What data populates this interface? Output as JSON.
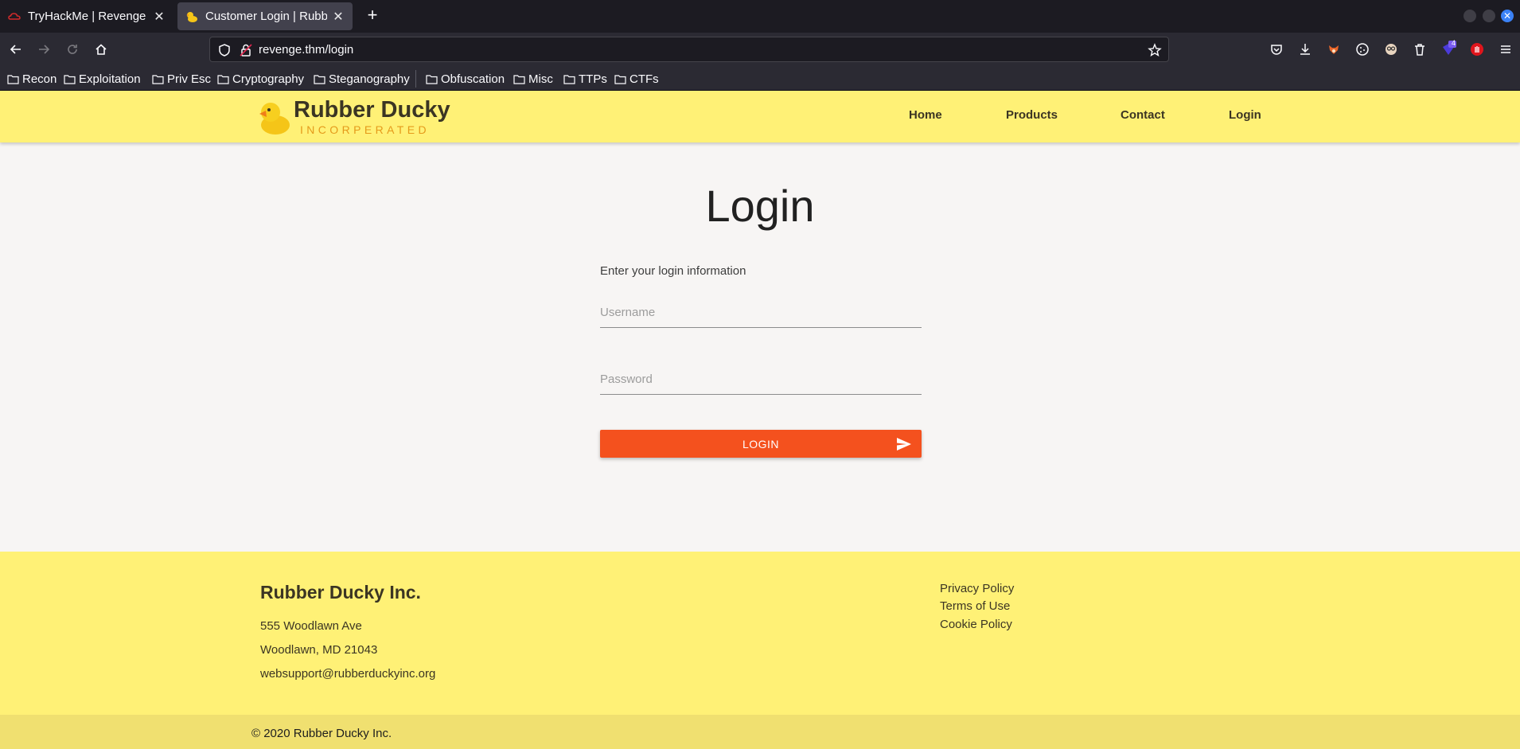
{
  "browser": {
    "tabs": [
      {
        "label": "TryHackMe | Revenge",
        "icon": "tryhackme-icon",
        "active": false
      },
      {
        "label": "Customer Login | Rubber Ducky Inc.",
        "icon": "rubber-duck-icon",
        "active": true
      }
    ],
    "url": "revenge.thm/login",
    "bookmarks": [
      "Recon",
      "Exploitation",
      "Priv Esc",
      "Cryptography",
      "Steganography",
      "Obfuscation",
      "Misc",
      "TTPs",
      "CTFs"
    ],
    "extension_badge": "4",
    "colors": {
      "tabbar": "#1c1b22",
      "toolbar": "#2b2a33"
    }
  },
  "site": {
    "brand": "Rubber Ducky",
    "brand_sub": "INCORPERATED",
    "nav": [
      "Home",
      "Products",
      "Contact",
      "Login"
    ],
    "colors": {
      "header": "#fff176",
      "accent": "#f4511e",
      "text": "#3b3523"
    }
  },
  "login": {
    "title": "Login",
    "prompt": "Enter your login information",
    "username_placeholder": "Username",
    "password_placeholder": "Password",
    "button_label": "LOGIN"
  },
  "footer": {
    "company": "Rubber Ducky Inc.",
    "address_line1": "555 Woodlawn Ave",
    "address_line2": "Woodlawn, MD 21043",
    "email": "websupport@rubberduckyinc.org",
    "links": [
      "Privacy Policy",
      "Terms of Use",
      "Cookie Policy"
    ],
    "copyright": "© 2020 Rubber Ducky Inc."
  }
}
